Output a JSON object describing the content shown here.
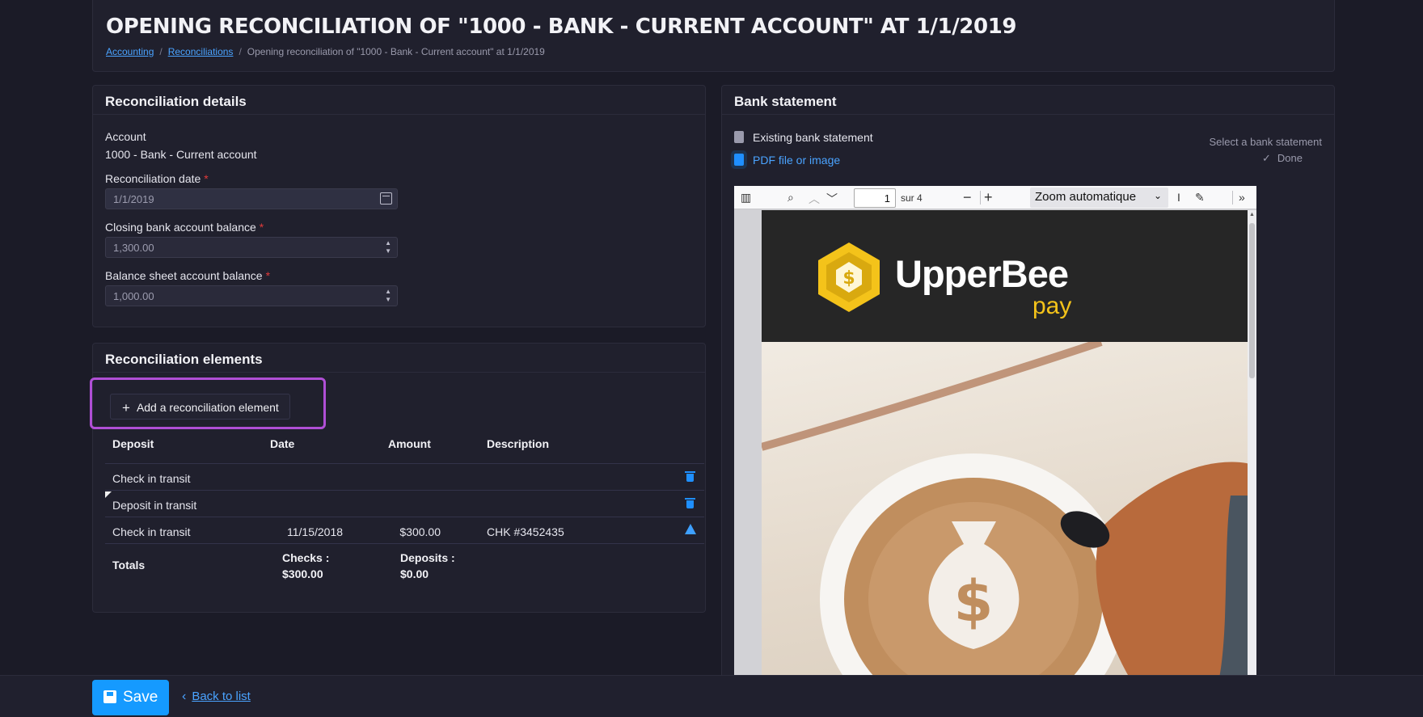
{
  "page": {
    "title": "OPENING RECONCILIATION OF \"1000 - BANK - CURRENT ACCOUNT\" AT 1/1/2019",
    "breadcrumb": [
      "Accounting",
      "Reconciliations",
      "Opening reconciliation of \"1000 - Bank - Current account\" at 1/1/2019"
    ],
    "breadcrumb_sep": "/"
  },
  "details": {
    "title": "Reconciliation details",
    "account_label": "Account",
    "account_value": "1000 - Bank - Current account",
    "date_label": "Reconciliation date",
    "date_value": "1/1/2019",
    "closing_label": "Closing bank account balance",
    "closing_value": "1,300.00",
    "balance_label": "Balance sheet account balance",
    "balance_value": "1,000.00",
    "required_mark": "*"
  },
  "elements": {
    "title": "Reconciliation elements",
    "add_label": "Add a reconciliation element",
    "columns": [
      "Deposit",
      "Date",
      "Amount",
      "Description"
    ],
    "rows": [
      {
        "deposit": "Check in transit",
        "date": "",
        "amount": "",
        "description": "",
        "action": "delete"
      },
      {
        "deposit": "Deposit in transit",
        "date": "",
        "amount": "",
        "description": "",
        "action": "delete"
      },
      {
        "deposit": "Check in transit",
        "date": "11/15/2018",
        "amount": "$300.00",
        "description": "CHK #3452435",
        "action": "warning"
      }
    ],
    "totals_label": "Totals",
    "checks_label": "Checks :",
    "checks_value": "$300.00",
    "deposits_label": "Deposits :",
    "deposits_value": "$0.00"
  },
  "statement": {
    "title": "Bank statement",
    "existing_label": "Existing bank statement",
    "pdf_label": "PDF file or image",
    "select_label": "Select a bank statement",
    "done_label": "Done",
    "viewer": {
      "page_value": "1",
      "page_total": "sur 4",
      "zoom": "Zoom automatique",
      "brand": "UpperBee",
      "brand_sub": "pay"
    }
  },
  "footer": {
    "save_label": "Save",
    "back_label": "Back to list"
  },
  "colors": {
    "accent": "#159aff",
    "link": "#4aa3ff",
    "highlight": "#b04fd6",
    "required": "#e03a3a",
    "brand_yellow": "#f4c31a"
  }
}
